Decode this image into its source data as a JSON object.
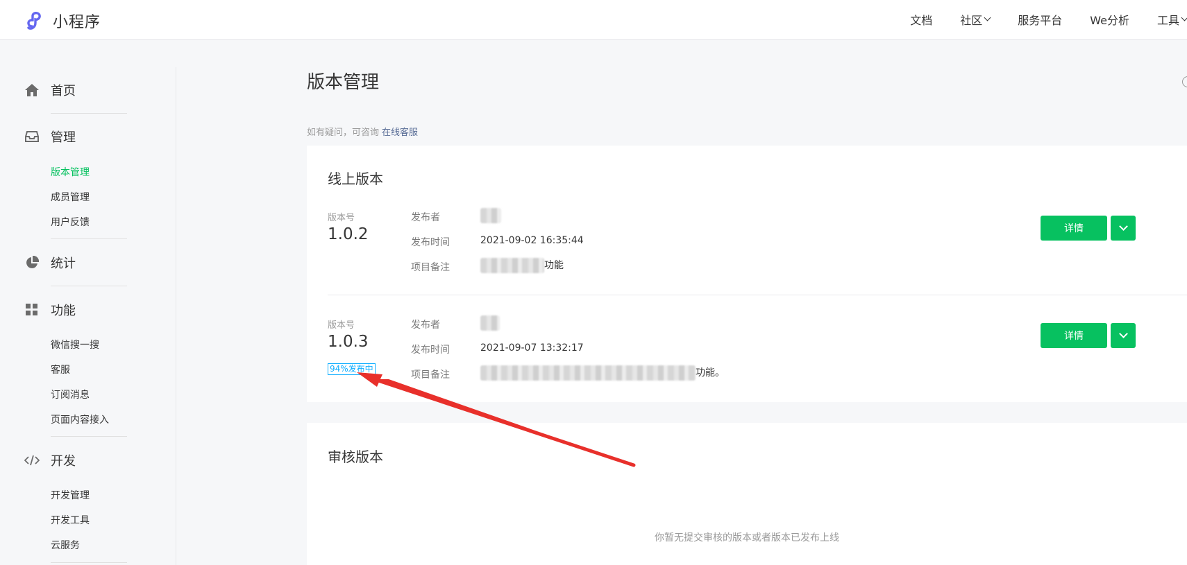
{
  "header": {
    "logo_text": "小程序",
    "nav": [
      {
        "label": "文档"
      },
      {
        "label": "社区"
      },
      {
        "label": "服务平台"
      },
      {
        "label": "We分析"
      },
      {
        "label": "工具"
      }
    ]
  },
  "sidebar": {
    "groups": [
      {
        "label": "首页",
        "icon": "home-icon"
      },
      {
        "label": "管理",
        "icon": "inbox-icon",
        "items": [
          "版本管理",
          "成员管理",
          "用户反馈"
        ]
      },
      {
        "label": "统计",
        "icon": "pie-chart-icon"
      },
      {
        "label": "功能",
        "icon": "grid-icon",
        "items": [
          "微信搜一搜",
          "客服",
          "订阅消息",
          "页面内容接入"
        ]
      },
      {
        "label": "开发",
        "icon": "code-icon",
        "items": [
          "开发管理",
          "开发工具",
          "云服务"
        ]
      }
    ],
    "active_item": "版本管理"
  },
  "main": {
    "title": "版本管理",
    "hint_text": "如有疑问，可咨询",
    "hint_link": "在线客服",
    "online": {
      "title": "线上版本",
      "versions": [
        {
          "label": "版本号",
          "version": "1.0.2",
          "publisher_label": "发布者",
          "time_label": "发布时间",
          "time": "2021-09-02 16:35:44",
          "note_label": "项目备注",
          "note_suffix": "功能",
          "detail_button": "详情"
        },
        {
          "label": "版本号",
          "version": "1.0.3",
          "badge": "94%发布中",
          "publisher_label": "发布者",
          "time_label": "发布时间",
          "time": "2021-09-07 13:32:17",
          "note_label": "项目备注",
          "note_suffix": "功能。",
          "detail_button": "详情"
        }
      ]
    },
    "review": {
      "title": "审核版本",
      "empty_text": "你暂无提交审核的版本或者版本已发布上线"
    }
  },
  "colors": {
    "accent_green": "#07c160",
    "link_blue": "#576b95",
    "badge_blue": "#10aeff",
    "annotation_arrow": "#e8302b"
  }
}
